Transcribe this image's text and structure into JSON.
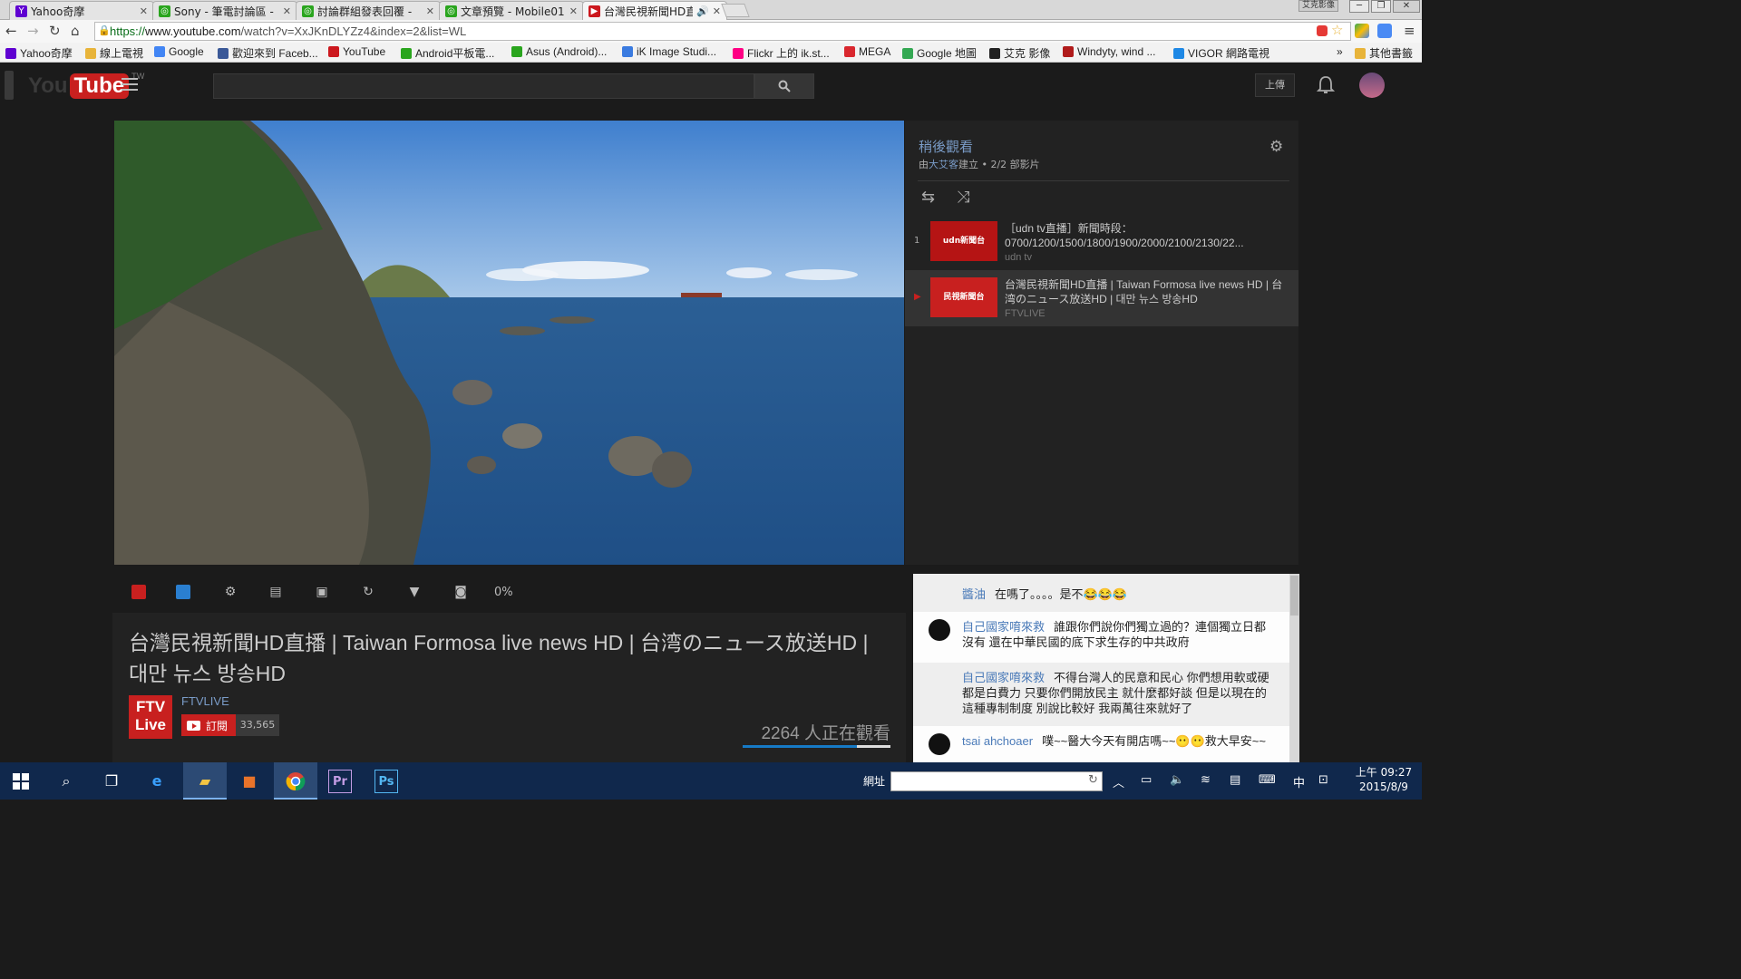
{
  "browser": {
    "tabs": [
      {
        "label": "Yahoo奇摩",
        "favicon": "yahoo-icon",
        "color": "#5f01d1",
        "glyph": "Y"
      },
      {
        "label": "Sony - 筆電討論區 -",
        "favicon": "forum-icon",
        "color": "#2aa51e",
        "glyph": "◎"
      },
      {
        "label": "討論群組發表回覆 -",
        "favicon": "forum-icon",
        "color": "#2aa51e",
        "glyph": "◎"
      },
      {
        "label": "文章預覽 - Mobile01",
        "favicon": "forum-icon",
        "color": "#2aa51e",
        "glyph": "◎"
      },
      {
        "label": "台灣民視新聞HD直",
        "favicon": "youtube-icon",
        "color": "#cc181e",
        "glyph": "▶",
        "audio": "🔊"
      }
    ],
    "profile_label": "艾克影像",
    "window_controls": [
      "─",
      "❐",
      "✕"
    ],
    "url_secure": "https://",
    "url_host": "www.youtube.com",
    "url_path": "/watch?v=XxJKnDLYZz4&index=2&list=WL",
    "bookmarks": [
      {
        "label": "Yahoo奇摩",
        "color": "#5f01d1"
      },
      {
        "label": "線上電視",
        "color": "#e8b43a"
      },
      {
        "label": "Google",
        "color": "#4285f4"
      },
      {
        "label": "歡迎來到 Faceb...",
        "color": "#3b5998"
      },
      {
        "label": "YouTube",
        "color": "#cc181e"
      },
      {
        "label": "Android平板電...",
        "color": "#2aa51e"
      },
      {
        "label": "Asus (Android)...",
        "color": "#2aa51e"
      },
      {
        "label": "iK Image Studi...",
        "color": "#3a7be0"
      },
      {
        "label": "Flickr 上的 ik.st...",
        "color": "#ff0084"
      },
      {
        "label": "MEGA",
        "color": "#d9272e"
      },
      {
        "label": "Google 地圖",
        "color": "#34a853"
      },
      {
        "label": "艾克 影像",
        "color": "#222222"
      },
      {
        "label": "Windyty, wind ...",
        "color": "#b01b1b"
      },
      {
        "label": "VIGOR 網路電視",
        "color": "#1e88e5"
      }
    ],
    "bookmarks_more": "»",
    "other_bookmarks": "其他書籤"
  },
  "youtube": {
    "logo_you": "You",
    "logo_tube": "Tube",
    "logo_region": "TW",
    "search_icon": "search-icon",
    "upload_label": "上傳",
    "playlist": {
      "title": "稍後觀看",
      "meta_prefix": "由",
      "owner": "大艾客",
      "meta_suffix": "建立 • 2/2 部影片",
      "items": [
        {
          "index": "1",
          "title": "［udn tv直播］新聞時段：0700/1200/1500/1800/1900/2000/2100/2130/22...",
          "channel": "udn tv",
          "current": false,
          "thumb_text": "udn新聞台"
        },
        {
          "index": "▶",
          "title": "台灣民視新聞HD直播 | Taiwan Formosa live news HD | 台湾のニュース放送HD | 대만 뉴스 방송HD",
          "channel": "FTVLIVE",
          "current": true,
          "thumb_text": "民視新聞台"
        }
      ]
    },
    "toolbar_percent": "0%",
    "video": {
      "title": "台灣民視新聞HD直播 | Taiwan Formosa live news HD | 台湾のニュース放送HD | 대만 뉴스 방송HD",
      "channel_logo_line1": "FTV",
      "channel_logo_line2": "Live",
      "channel": "FTVLIVE",
      "subscribe_label": "訂閱",
      "subscriber_count": "33,565",
      "viewers": "2264 人正在觀看",
      "like_ratio": 0.77
    },
    "chat": [
      {
        "author": "醬油",
        "text": "在嗎了。。。。是不😂😂😂",
        "style": "plain",
        "avatar": false
      },
      {
        "author": "自己國家唷來救",
        "text": "誰跟你們說你們獨立過的？連個獨立日都沒有 還在中華民國的底下求生存的中共政府",
        "style": "light",
        "avatar": true
      },
      {
        "author": "自己國家唷來救",
        "text": "不得台灣人的民意和民心 你們想用軟或硬 都是白費力 只要你們開放民主 就什麼都好談 但是以現在的這種專制制度 別說比較好 我兩萬往來就好了",
        "style": "plain",
        "avatar": false
      },
      {
        "author": "tsai ahchoaer",
        "text": "噗~~醫大今天有開店嗎~~😶😶救大早安~~",
        "style": "light",
        "avatar": true
      }
    ]
  },
  "taskbar": {
    "address_label": "網址",
    "ime": "中",
    "time": "上午 09:27",
    "date": "2015/8/9"
  }
}
